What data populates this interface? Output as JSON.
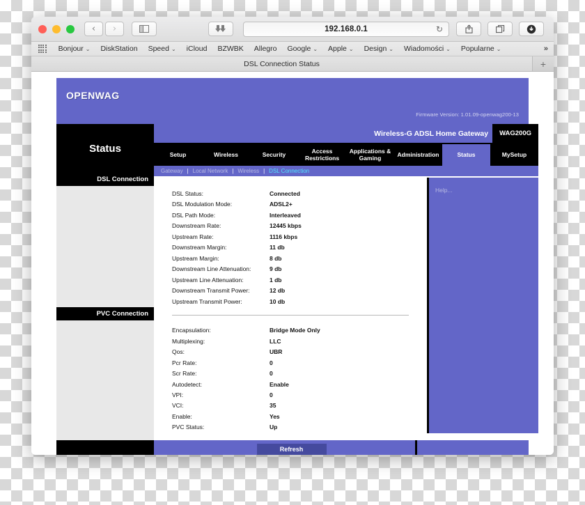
{
  "browser": {
    "url": "192.168.0.1",
    "tab_title": "DSL Connection Status",
    "new_tab_label": "+",
    "reload_glyph": "↻",
    "back_glyph": "‹",
    "forward_glyph": "›",
    "overflow_label": "»",
    "bookmarks": [
      {
        "label": "Bonjour",
        "caret": "⌄"
      },
      {
        "label": "DiskStation",
        "caret": ""
      },
      {
        "label": "Speed",
        "caret": "⌄"
      },
      {
        "label": "iCloud",
        "caret": ""
      },
      {
        "label": "BZWBK",
        "caret": ""
      },
      {
        "label": "Allegro",
        "caret": ""
      },
      {
        "label": "Google",
        "caret": "⌄"
      },
      {
        "label": "Apple",
        "caret": "⌄"
      },
      {
        "label": "Design",
        "caret": "⌄"
      },
      {
        "label": "Wiadomości",
        "caret": "⌄"
      },
      {
        "label": "Popularne",
        "caret": "⌄"
      }
    ]
  },
  "router": {
    "logo": "OpenWAG",
    "firmware": "Firmware Version: 1.01.09-openwag200-13",
    "status_label": "Status",
    "gateway_title": "Wireless-G ADSL Home Gateway",
    "model": "WAG200G",
    "nav_tabs": [
      {
        "label": "Setup",
        "active": false
      },
      {
        "label": "Wireless",
        "active": false
      },
      {
        "label": "Security",
        "active": false
      },
      {
        "label": "Access Restrictions",
        "active": false
      },
      {
        "label": "Applications & Gaming",
        "active": false
      },
      {
        "label": "Administration",
        "active": false
      },
      {
        "label": "Status",
        "active": true
      },
      {
        "label": "MySetup",
        "active": false
      }
    ],
    "sub_tabs": [
      {
        "label": "Gateway",
        "active": false
      },
      {
        "label": "Local Network",
        "active": false
      },
      {
        "label": "Wireless",
        "active": false
      },
      {
        "label": "DSL Connection",
        "active": true
      }
    ],
    "sections": [
      {
        "title": "DSL Connection",
        "rows": [
          {
            "label": "DSL Status:",
            "value": "Connected"
          },
          {
            "label": "DSL Modulation Mode:",
            "value": "ADSL2+"
          },
          {
            "label": "DSL Path Mode:",
            "value": "Interleaved"
          },
          {
            "label": "Downstream Rate:",
            "value": "12445 kbps"
          },
          {
            "label": "Upstream Rate:",
            "value": "1116 kbps"
          },
          {
            "label": "Downstream Margin:",
            "value": "11 db"
          },
          {
            "label": "Upstream Margin:",
            "value": "8 db"
          },
          {
            "label": "Downstream Line Attenuation:",
            "value": "9 db"
          },
          {
            "label": "Upstream Line Attenuation:",
            "value": "1 db"
          },
          {
            "label": "Downstream Transmit Power:",
            "value": "12 db"
          },
          {
            "label": "Upstream Transmit Power:",
            "value": "10 db"
          }
        ]
      },
      {
        "title": "PVC Connection",
        "rows": [
          {
            "label": "Encapsulation:",
            "value": "Bridge Mode Only"
          },
          {
            "label": "Multiplexing:",
            "value": "LLC"
          },
          {
            "label": "Qos:",
            "value": "UBR"
          },
          {
            "label": "Pcr Rate:",
            "value": "0"
          },
          {
            "label": "Scr Rate:",
            "value": "0"
          },
          {
            "label": "Autodetect:",
            "value": "Enable"
          },
          {
            "label": "VPI:",
            "value": "0"
          },
          {
            "label": "VCI:",
            "value": "35"
          },
          {
            "label": "Enable:",
            "value": "Yes"
          },
          {
            "label": "PVC Status:",
            "value": "Up"
          }
        ]
      }
    ],
    "help_text": "Help...",
    "refresh_label": "Refresh"
  },
  "colors": {
    "purple": "#6366c8",
    "black": "#000000",
    "active_subtab": "#52e6ff",
    "button": "#454a9e"
  }
}
